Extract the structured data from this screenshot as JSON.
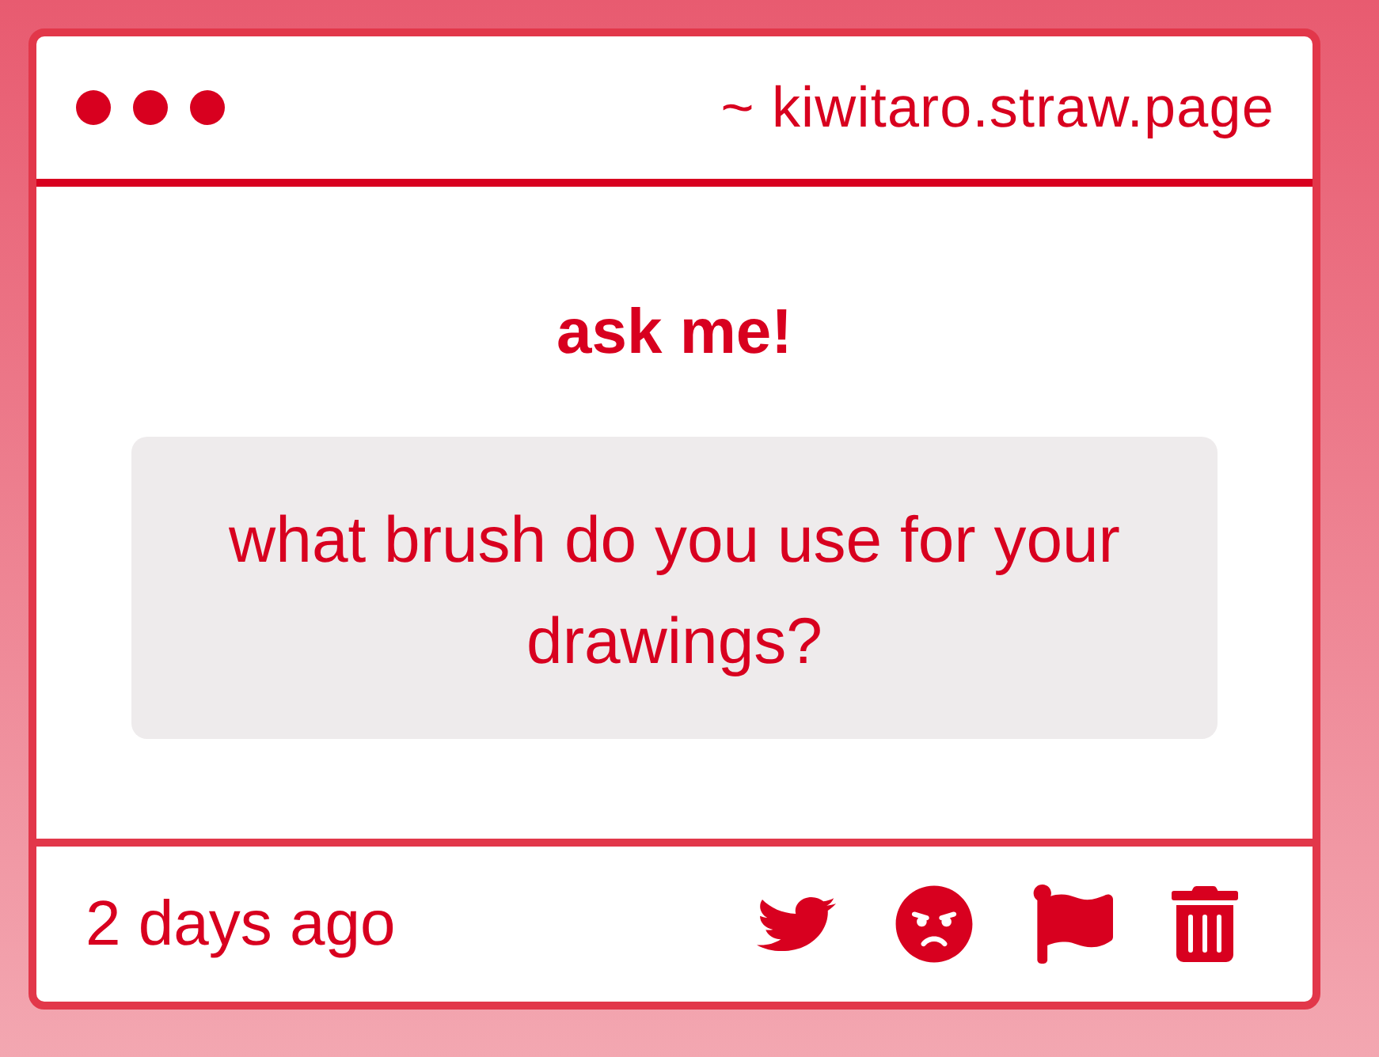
{
  "window": {
    "address": "~ kiwitaro.straw.page"
  },
  "card": {
    "title": "ask me!",
    "question": "what brush do you use for your drawings?"
  },
  "footer": {
    "time": "2 days ago"
  }
}
